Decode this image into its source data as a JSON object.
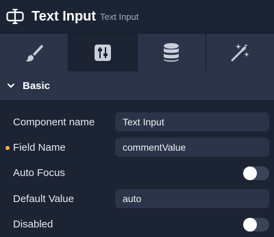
{
  "header": {
    "title": "Text Input",
    "subtitle": "Text Input",
    "icon": "text-input-icon"
  },
  "tabs": [
    {
      "icon": "paintbrush-icon",
      "active": false
    },
    {
      "icon": "sliders-icon",
      "active": true
    },
    {
      "icon": "database-icon",
      "active": false
    },
    {
      "icon": "magic-wand-icon",
      "active": false
    }
  ],
  "section": {
    "label": "Basic",
    "expanded": true
  },
  "properties": {
    "component_name": {
      "label": "Component name",
      "value": "Text Input"
    },
    "field_name": {
      "label": "Field Name",
      "value": "commentValue",
      "modified": true
    },
    "auto_focus": {
      "label": "Auto Focus",
      "enabled": false
    },
    "default_value": {
      "label": "Default Value",
      "value": "auto"
    },
    "disabled": {
      "label": "Disabled",
      "enabled": false
    }
  },
  "colors": {
    "background": "#1c2333",
    "panel": "#2b3448",
    "modified_dot": "#f0b34a"
  }
}
